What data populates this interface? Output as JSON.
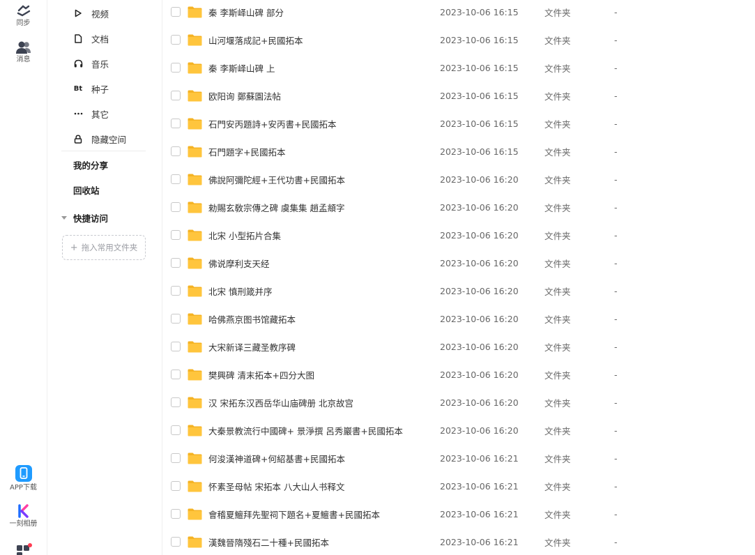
{
  "rail": {
    "sync_label": "同步",
    "message_label": "消息",
    "app_label": "APP下载",
    "album_label": "一刻相册"
  },
  "sidebar": {
    "items": [
      {
        "label": "视频",
        "icon": "play-icon"
      },
      {
        "label": "文档",
        "icon": "document-icon"
      },
      {
        "label": "音乐",
        "icon": "headphones-icon"
      },
      {
        "label": "种子",
        "icon": "bt-icon"
      },
      {
        "label": "其它",
        "icon": "more-icon"
      },
      {
        "label": "隐藏空间",
        "icon": "lock-icon"
      }
    ],
    "my_share": "我的分享",
    "recycle_bin": "回收站",
    "quick_access": "快捷访问",
    "drop_hint": "拖入常用文件夹",
    "bt_glyph": "Bt"
  },
  "files": [
    {
      "name": "秦 李斯峄山碑 部分",
      "date": "2023-10-06 16:15",
      "type": "文件夹",
      "size": "-"
    },
    {
      "name": "山河堰落成記+民國拓本",
      "date": "2023-10-06 16:15",
      "type": "文件夹",
      "size": "-"
    },
    {
      "name": "秦 李斯峄山碑 上",
      "date": "2023-10-06 16:15",
      "type": "文件夹",
      "size": "-"
    },
    {
      "name": "欧阳询 鄭蘇園法帖",
      "date": "2023-10-06 16:15",
      "type": "文件夹",
      "size": "-"
    },
    {
      "name": "石門安丙題詩+安丙書+民國拓本",
      "date": "2023-10-06 16:15",
      "type": "文件夹",
      "size": "-"
    },
    {
      "name": "石門題字+民國拓本",
      "date": "2023-10-06 16:15",
      "type": "文件夹",
      "size": "-"
    },
    {
      "name": "佛說阿彌陀經+王代功書+民國拓本",
      "date": "2023-10-06 16:20",
      "type": "文件夹",
      "size": "-"
    },
    {
      "name": "勑賜玄敎宗傳之碑 虞集集 趙孟頫字",
      "date": "2023-10-06 16:20",
      "type": "文件夹",
      "size": "-"
    },
    {
      "name": "北宋 小型拓片合集",
      "date": "2023-10-06 16:20",
      "type": "文件夹",
      "size": "-"
    },
    {
      "name": "佛说摩利支天经",
      "date": "2023-10-06 16:20",
      "type": "文件夹",
      "size": "-"
    },
    {
      "name": "北宋 慎刑箴并序",
      "date": "2023-10-06 16:20",
      "type": "文件夹",
      "size": "-"
    },
    {
      "name": "哈佛燕京图书馆藏拓本",
      "date": "2023-10-06 16:20",
      "type": "文件夹",
      "size": "-"
    },
    {
      "name": "大宋新译三藏圣教序碑",
      "date": "2023-10-06 16:20",
      "type": "文件夹",
      "size": "-"
    },
    {
      "name": "樊興碑 清末拓本+四分大图",
      "date": "2023-10-06 16:20",
      "type": "文件夹",
      "size": "-"
    },
    {
      "name": "汉 宋拓东汉西岳华山庙碑册 北京故宫",
      "date": "2023-10-06 16:20",
      "type": "文件夹",
      "size": "-"
    },
    {
      "name": "大秦景教流行中國碑+ 景淨撰 呂秀巖書+民國拓本",
      "date": "2023-10-06 16:20",
      "type": "文件夹",
      "size": "-"
    },
    {
      "name": "何浚漢神道碑+何紹基書+民國拓本",
      "date": "2023-10-06 16:21",
      "type": "文件夹",
      "size": "-"
    },
    {
      "name": "怀素圣母帖 宋拓本 八大山人书释文",
      "date": "2023-10-06 16:21",
      "type": "文件夹",
      "size": "-"
    },
    {
      "name": "會稽夏鱣拜先聖祠下題名+夏鱣書+民國拓本",
      "date": "2023-10-06 16:21",
      "type": "文件夹",
      "size": "-"
    },
    {
      "name": "漢魏晉隋殘石二十種+民國拓本",
      "date": "2023-10-06 16:21",
      "type": "文件夹",
      "size": "-"
    }
  ],
  "colors": {
    "folder": "#FFC53D",
    "folder_tab": "#F5B324",
    "accent_blue": "#1677FF"
  }
}
